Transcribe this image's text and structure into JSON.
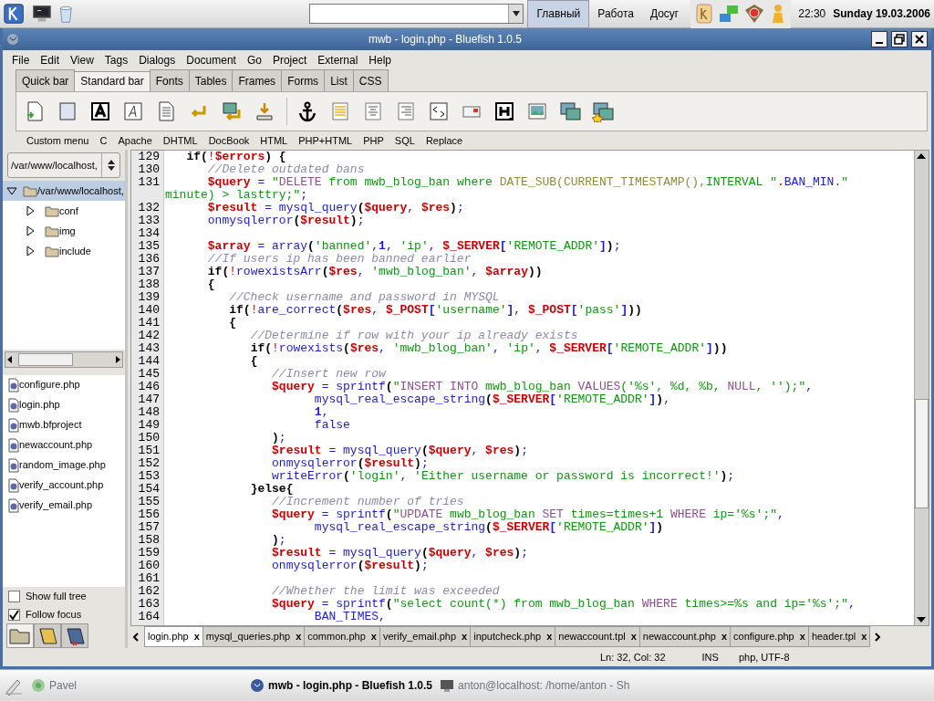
{
  "top_panel": {
    "desktops": [
      {
        "label": "Главный",
        "selected": true
      },
      {
        "label": "Работа",
        "selected": false
      },
      {
        "label": "Досуг",
        "selected": false
      }
    ],
    "clock": "22:30",
    "date": "Sunday 19.03.2006"
  },
  "window": {
    "title": "mwb - login.php - Bluefish 1.0.5"
  },
  "menu": [
    "File",
    "Edit",
    "View",
    "Tags",
    "Dialogs",
    "Document",
    "Go",
    "Project",
    "External",
    "Help"
  ],
  "toolbar_tabs": [
    {
      "label": "Quick bar",
      "selected": false
    },
    {
      "label": "Standard bar",
      "selected": true
    },
    {
      "label": "Fonts",
      "selected": false
    },
    {
      "label": "Tables",
      "selected": false
    },
    {
      "label": "Frames",
      "selected": false
    },
    {
      "label": "Forms",
      "selected": false
    },
    {
      "label": "List",
      "selected": false
    },
    {
      "label": "CSS",
      "selected": false
    }
  ],
  "custom_menu": [
    "Custom menu",
    "C",
    "Apache",
    "DHTML",
    "DocBook",
    "HTML",
    "PHP+HTML",
    "PHP",
    "SQL",
    "Replace"
  ],
  "sidebar": {
    "location": "/var/www/localhost,",
    "tree": [
      {
        "label": "/var/www/localhost,",
        "expanded": true,
        "selected": true,
        "children": [
          {
            "label": "conf",
            "expanded": false,
            "selected": false
          },
          {
            "label": "img",
            "expanded": false,
            "selected": false
          },
          {
            "label": "include",
            "expanded": false,
            "selected": false
          }
        ]
      }
    ],
    "files": [
      "configure.php",
      "login.php",
      "mwb.bfproject",
      "newaccount.php",
      "random_image.php",
      "verify_account.php",
      "verify_email.php"
    ],
    "options": [
      {
        "label": "Show full tree",
        "checked": false
      },
      {
        "label": "Follow focus",
        "checked": true
      }
    ],
    "view_tabs": [
      {
        "kind": "folder",
        "selected": true
      },
      {
        "kind": "book",
        "selected": false
      },
      {
        "kind": "bookmark",
        "selected": false
      }
    ]
  },
  "editor": {
    "lines": [
      {
        "number": "129",
        "segments": [
          {
            "text": "   if(",
            "kind": "punct"
          },
          {
            "text": "!",
            "kind": "bang"
          },
          {
            "text": "$errors",
            "kind": "var"
          },
          {
            "text": ") {",
            "kind": "punct"
          }
        ]
      },
      {
        "number": "130",
        "segments": [
          {
            "text": "      //Delete outdated bans",
            "kind": "comment"
          }
        ]
      },
      {
        "number": "131",
        "segments": [
          {
            "text": "      $query",
            "kind": "var"
          },
          {
            "text": " = ",
            "kind": "op"
          },
          {
            "text": "\"",
            "kind": "string"
          },
          {
            "text": "DELETE",
            "kind": "sql"
          },
          {
            "text": " from mwb_blog_ban where ",
            "kind": "string"
          },
          {
            "text": "DATE_SUB(CURRENT_TIMESTAMP(),",
            "kind": "sqlfn"
          },
          {
            "text": "INTERVAL \"",
            "kind": "string"
          },
          {
            "text": ".",
            "kind": "bang"
          },
          {
            "text": "BAN_MIN",
            "kind": "func"
          },
          {
            "text": ".",
            "kind": "bang"
          },
          {
            "text": "\" minute) > lasttry;\"",
            "kind": "string"
          },
          {
            "text": ";",
            "kind": "op"
          }
        ]
      },
      {
        "number": "132",
        "segments": [
          {
            "text": "      $result",
            "kind": "var"
          },
          {
            "text": " = ",
            "kind": "op"
          },
          {
            "text": "mysql_query",
            "kind": "func"
          },
          {
            "text": "(",
            "kind": "punct"
          },
          {
            "text": "$query",
            "kind": "var"
          },
          {
            "text": ", ",
            "kind": "op"
          },
          {
            "text": "$res",
            "kind": "var"
          },
          {
            "text": ")",
            "kind": "punct"
          },
          {
            "text": ";",
            "kind": "op"
          }
        ]
      },
      {
        "number": "133",
        "segments": [
          {
            "text": "      onmysqlerror",
            "kind": "func"
          },
          {
            "text": "(",
            "kind": "punct"
          },
          {
            "text": "$result",
            "kind": "var"
          },
          {
            "text": ")",
            "kind": "punct"
          },
          {
            "text": ";",
            "kind": "op"
          }
        ]
      },
      {
        "number": "134"
      },
      {
        "number": "135",
        "segments": [
          {
            "text": "      $array",
            "kind": "var"
          },
          {
            "text": " = ",
            "kind": "op"
          },
          {
            "text": "array",
            "kind": "func"
          },
          {
            "text": "(",
            "kind": "punct"
          },
          {
            "text": "'banned'",
            "kind": "string"
          },
          {
            "text": ",",
            "kind": "op"
          },
          {
            "text": "1",
            "kind": "num"
          },
          {
            "text": ", ",
            "kind": "op"
          },
          {
            "text": "'ip'",
            "kind": "string"
          },
          {
            "text": ", ",
            "kind": "op"
          },
          {
            "text": "$_SERVER",
            "kind": "var"
          },
          {
            "text": "[",
            "kind": "bracket"
          },
          {
            "text": "'REMOTE_ADDR'",
            "kind": "string"
          },
          {
            "text": "]",
            "kind": "bracket"
          },
          {
            "text": ")",
            "kind": "punct"
          },
          {
            "text": ";",
            "kind": "op"
          }
        ]
      },
      {
        "number": "136",
        "segments": [
          {
            "text": "      //If users ip has been banned earlier",
            "kind": "comment"
          }
        ]
      },
      {
        "number": "137",
        "segments": [
          {
            "text": "      if(",
            "kind": "punct"
          },
          {
            "text": "!",
            "kind": "bang"
          },
          {
            "text": "rowexistsArr",
            "kind": "func"
          },
          {
            "text": "(",
            "kind": "punct"
          },
          {
            "text": "$res",
            "kind": "var"
          },
          {
            "text": ", ",
            "kind": "op"
          },
          {
            "text": "'mwb_blog_ban'",
            "kind": "string"
          },
          {
            "text": ", ",
            "kind": "op"
          },
          {
            "text": "$array",
            "kind": "var"
          },
          {
            "text": "))",
            "kind": "punct"
          }
        ]
      },
      {
        "number": "138",
        "segments": [
          {
            "text": "      {",
            "kind": "punct"
          }
        ]
      },
      {
        "number": "139",
        "segments": [
          {
            "text": "         //Check username and password in MYSQL",
            "kind": "comment"
          }
        ]
      },
      {
        "number": "140",
        "segments": [
          {
            "text": "         if(",
            "kind": "punct"
          },
          {
            "text": "!",
            "kind": "bang"
          },
          {
            "text": "are_correct",
            "kind": "func"
          },
          {
            "text": "(",
            "kind": "punct"
          },
          {
            "text": "$res",
            "kind": "var"
          },
          {
            "text": ", ",
            "kind": "op"
          },
          {
            "text": "$_POST",
            "kind": "var"
          },
          {
            "text": "[",
            "kind": "bracket"
          },
          {
            "text": "'username'",
            "kind": "string"
          },
          {
            "text": "]",
            "kind": "bracket"
          },
          {
            "text": ", ",
            "kind": "op"
          },
          {
            "text": "$_POST",
            "kind": "var"
          },
          {
            "text": "[",
            "kind": "bracket"
          },
          {
            "text": "'pass'",
            "kind": "string"
          },
          {
            "text": "]",
            "kind": "bracket"
          },
          {
            "text": "))",
            "kind": "punct"
          }
        ]
      },
      {
        "number": "141",
        "segments": [
          {
            "text": "         {",
            "kind": "punct"
          }
        ]
      },
      {
        "number": "142",
        "segments": [
          {
            "text": "            //Determine if row with your ip already exists",
            "kind": "comment"
          }
        ]
      },
      {
        "number": "143",
        "segments": [
          {
            "text": "            if(",
            "kind": "punct"
          },
          {
            "text": "!",
            "kind": "bang"
          },
          {
            "text": "rowexists",
            "kind": "func"
          },
          {
            "text": "(",
            "kind": "punct"
          },
          {
            "text": "$res",
            "kind": "var"
          },
          {
            "text": ", ",
            "kind": "op"
          },
          {
            "text": "'mwb_blog_ban'",
            "kind": "string"
          },
          {
            "text": ", ",
            "kind": "op"
          },
          {
            "text": "'ip'",
            "kind": "string"
          },
          {
            "text": ", ",
            "kind": "op"
          },
          {
            "text": "$_SERVER",
            "kind": "var"
          },
          {
            "text": "[",
            "kind": "bracket"
          },
          {
            "text": "'REMOTE_ADDR'",
            "kind": "string"
          },
          {
            "text": "]",
            "kind": "bracket"
          },
          {
            "text": "))",
            "kind": "punct"
          }
        ]
      },
      {
        "number": "144",
        "segments": [
          {
            "text": "            {",
            "kind": "punct"
          }
        ]
      },
      {
        "number": "145",
        "segments": [
          {
            "text": "               //Insert new row",
            "kind": "comment"
          }
        ]
      },
      {
        "number": "146",
        "segments": [
          {
            "text": "               $query",
            "kind": "var"
          },
          {
            "text": " = ",
            "kind": "op"
          },
          {
            "text": "sprintf",
            "kind": "func"
          },
          {
            "text": "(",
            "kind": "punct"
          },
          {
            "text": "\"",
            "kind": "string"
          },
          {
            "text": "INSERT INTO",
            "kind": "sql"
          },
          {
            "text": " mwb_blog_ban ",
            "kind": "string"
          },
          {
            "text": "VALUES",
            "kind": "sql"
          },
          {
            "text": "('%s', %d, %b, ",
            "kind": "string"
          },
          {
            "text": "NULL",
            "kind": "sql"
          },
          {
            "text": ", '');\"",
            "kind": "string"
          },
          {
            "text": ",",
            "kind": "op"
          }
        ]
      },
      {
        "number": "147",
        "segments": [
          {
            "text": "                     mysql_real_escape_string",
            "kind": "func"
          },
          {
            "text": "(",
            "kind": "punct"
          },
          {
            "text": "$_SERVER",
            "kind": "var"
          },
          {
            "text": "[",
            "kind": "bracket"
          },
          {
            "text": "'REMOTE_ADDR'",
            "kind": "string"
          },
          {
            "text": "]",
            "kind": "bracket"
          },
          {
            "text": ")",
            "kind": "punct"
          },
          {
            "text": ",",
            "kind": "op"
          }
        ]
      },
      {
        "number": "148",
        "segments": [
          {
            "text": "                     1",
            "kind": "num"
          },
          {
            "text": ",",
            "kind": "op"
          }
        ]
      },
      {
        "number": "149",
        "segments": [
          {
            "text": "                     false",
            "kind": "func"
          }
        ]
      },
      {
        "number": "150",
        "segments": [
          {
            "text": "               )",
            "kind": "punct"
          },
          {
            "text": ";",
            "kind": "op"
          }
        ]
      },
      {
        "number": "151",
        "segments": [
          {
            "text": "               $result",
            "kind": "var"
          },
          {
            "text": " = ",
            "kind": "op"
          },
          {
            "text": "mysql_query",
            "kind": "func"
          },
          {
            "text": "(",
            "kind": "punct"
          },
          {
            "text": "$query",
            "kind": "var"
          },
          {
            "text": ", ",
            "kind": "op"
          },
          {
            "text": "$res",
            "kind": "var"
          },
          {
            "text": ")",
            "kind": "punct"
          },
          {
            "text": ";",
            "kind": "op"
          }
        ]
      },
      {
        "number": "152",
        "segments": [
          {
            "text": "               onmysqlerror",
            "kind": "func"
          },
          {
            "text": "(",
            "kind": "punct"
          },
          {
            "text": "$result",
            "kind": "var"
          },
          {
            "text": ")",
            "kind": "punct"
          },
          {
            "text": ";",
            "kind": "op"
          }
        ]
      },
      {
        "number": "153",
        "segments": [
          {
            "text": "               writeError",
            "kind": "func"
          },
          {
            "text": "(",
            "kind": "punct"
          },
          {
            "text": "'login'",
            "kind": "string"
          },
          {
            "text": ", ",
            "kind": "op"
          },
          {
            "text": "'Either username or password is incorrect!'",
            "kind": "string"
          },
          {
            "text": ")",
            "kind": "punct"
          },
          {
            "text": ";",
            "kind": "op"
          }
        ]
      },
      {
        "number": "154",
        "segments": [
          {
            "text": "            }else{",
            "kind": "punct"
          }
        ]
      },
      {
        "number": "155",
        "segments": [
          {
            "text": "               //Increment number of tries",
            "kind": "comment"
          }
        ]
      },
      {
        "number": "156",
        "segments": [
          {
            "text": "               $query",
            "kind": "var"
          },
          {
            "text": " = ",
            "kind": "op"
          },
          {
            "text": "sprintf",
            "kind": "func"
          },
          {
            "text": "(",
            "kind": "punct"
          },
          {
            "text": "\"",
            "kind": "string"
          },
          {
            "text": "UPDATE",
            "kind": "sql"
          },
          {
            "text": " mwb_blog_ban ",
            "kind": "string"
          },
          {
            "text": "SET",
            "kind": "sql"
          },
          {
            "text": " times=times+1 ",
            "kind": "string"
          },
          {
            "text": "WHERE",
            "kind": "sql"
          },
          {
            "text": " ip='%s';\"",
            "kind": "string"
          },
          {
            "text": ",",
            "kind": "op"
          }
        ]
      },
      {
        "number": "157",
        "segments": [
          {
            "text": "                     mysql_real_escape_string",
            "kind": "func"
          },
          {
            "text": "(",
            "kind": "punct"
          },
          {
            "text": "$_SERVER",
            "kind": "var"
          },
          {
            "text": "[",
            "kind": "bracket"
          },
          {
            "text": "'REMOTE_ADDR'",
            "kind": "string"
          },
          {
            "text": "]",
            "kind": "bracket"
          },
          {
            "text": ")",
            "kind": "punct"
          }
        ]
      },
      {
        "number": "158",
        "segments": [
          {
            "text": "               )",
            "kind": "punct"
          },
          {
            "text": ";",
            "kind": "op"
          }
        ]
      },
      {
        "number": "159",
        "segments": [
          {
            "text": "               $result",
            "kind": "var"
          },
          {
            "text": " = ",
            "kind": "op"
          },
          {
            "text": "mysql_query",
            "kind": "func"
          },
          {
            "text": "(",
            "kind": "punct"
          },
          {
            "text": "$query",
            "kind": "var"
          },
          {
            "text": ", ",
            "kind": "op"
          },
          {
            "text": "$res",
            "kind": "var"
          },
          {
            "text": ")",
            "kind": "punct"
          },
          {
            "text": ";",
            "kind": "op"
          }
        ]
      },
      {
        "number": "160",
        "segments": [
          {
            "text": "               onmysqlerror",
            "kind": "func"
          },
          {
            "text": "(",
            "kind": "punct"
          },
          {
            "text": "$result",
            "kind": "var"
          },
          {
            "text": ")",
            "kind": "punct"
          },
          {
            "text": ";",
            "kind": "op"
          }
        ]
      },
      {
        "number": "161"
      },
      {
        "number": "162",
        "segments": [
          {
            "text": "               //Whether the limit was exceeded",
            "kind": "comment"
          }
        ]
      },
      {
        "number": "163",
        "segments": [
          {
            "text": "               $query",
            "kind": "var"
          },
          {
            "text": " = ",
            "kind": "op"
          },
          {
            "text": "sprintf",
            "kind": "func"
          },
          {
            "text": "(",
            "kind": "punct"
          },
          {
            "text": "\"select count(*) from mwb_blog_ban ",
            "kind": "string"
          },
          {
            "text": "WHERE",
            "kind": "sql"
          },
          {
            "text": " times>=%s and ip='%s';\"",
            "kind": "string"
          },
          {
            "text": ",",
            "kind": "op"
          }
        ]
      },
      {
        "number": "164",
        "segments": [
          {
            "text": "                     BAN_TIMES",
            "kind": "func"
          },
          {
            "text": ",",
            "kind": "op"
          }
        ]
      }
    ]
  },
  "document_tabs": [
    {
      "label": "login.php",
      "selected": true,
      "close": "x"
    },
    {
      "label": "mysql_queries.php",
      "selected": false,
      "close": "x"
    },
    {
      "label": "common.php",
      "selected": false,
      "close": "x"
    },
    {
      "label": "verify_email.php",
      "selected": false,
      "close": "x"
    },
    {
      "label": "inputcheck.php",
      "selected": false,
      "close": "x"
    },
    {
      "label": "newaccount.tpl",
      "selected": false,
      "close": "x"
    },
    {
      "label": "newaccount.php",
      "selected": false,
      "close": "x"
    },
    {
      "label": "configure.php",
      "selected": false,
      "close": "x"
    },
    {
      "label": "header.tpl",
      "selected": false,
      "close": "x"
    }
  ],
  "status_bar": {
    "position": "Ln: 32, Col: 32",
    "mode": "INS",
    "file_type": "php, UTF-8"
  },
  "taskbar": {
    "user": "Pavel",
    "tasks": [
      {
        "label": "mwb - login.php - Bluefish 1.0.5",
        "active": true
      },
      {
        "label": "anton@localhost: /home/anton - Sh",
        "active": false
      }
    ]
  }
}
